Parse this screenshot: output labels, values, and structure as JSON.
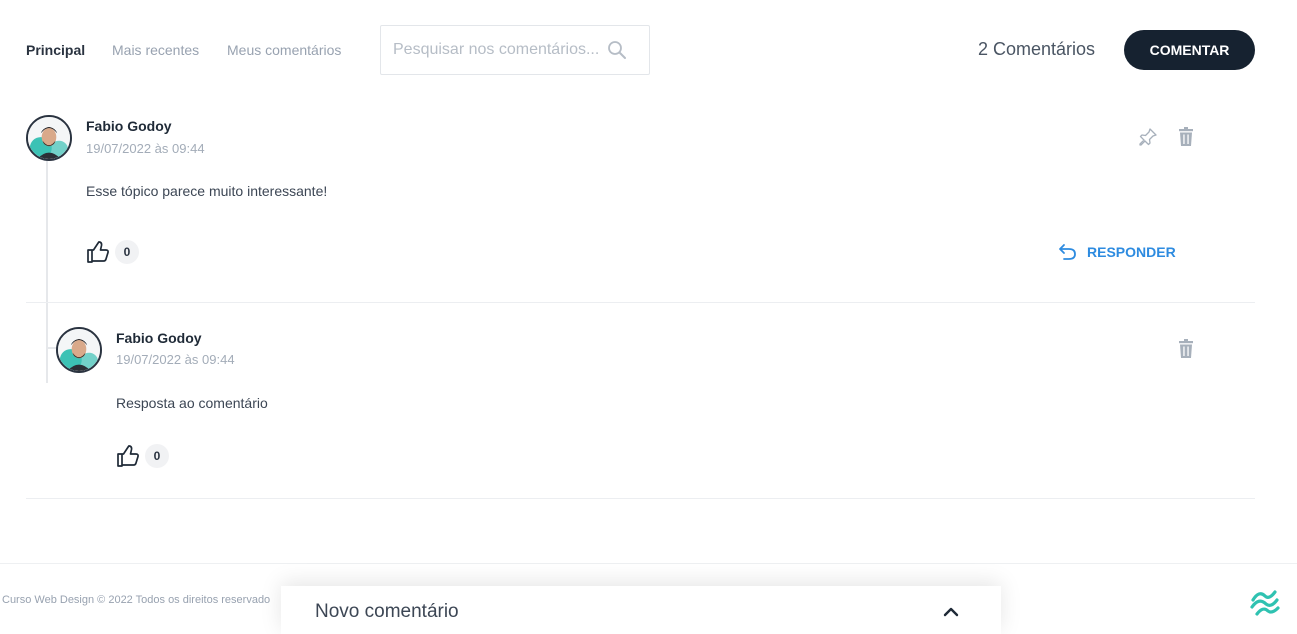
{
  "tabs": [
    {
      "label": "Principal",
      "active": true
    },
    {
      "label": "Mais recentes",
      "active": false
    },
    {
      "label": "Meus comentários",
      "active": false
    }
  ],
  "search": {
    "placeholder": "Pesquisar nos comentários...",
    "value": "",
    "icon": "search-icon"
  },
  "comment_count_label": "2 Comentários",
  "comment_button_label": "COMENTAR",
  "comments": [
    {
      "author": "Fabio Godoy",
      "date": "19/07/2022 às 09:44",
      "text": "Esse tópico parece muito interessante!",
      "likes": "0",
      "reply_label": "RESPONDER",
      "icons": [
        "pin-icon",
        "trash-icon",
        "thumbs-up-icon",
        "reply-arrow-icon"
      ]
    },
    {
      "author": "Fabio Godoy",
      "date": "19/07/2022 às 09:44",
      "text": "Resposta ao comentário",
      "likes": "0",
      "icons": [
        "trash-icon",
        "thumbs-up-icon"
      ]
    }
  ],
  "footer": {
    "copyright": "Curso Web Design © 2022 Todos os direitos reservado",
    "logo_icon": "brand-logo-icon"
  },
  "new_comment": {
    "title": "Novo comentário",
    "icon": "chevron-up-icon"
  },
  "colors": {
    "primary_button": "#162230",
    "reply_link": "#2d8be0",
    "muted_text": "#98a2b0",
    "avatar_accent": "#3cc2b5",
    "brand_logo": "#2fc2b1"
  }
}
